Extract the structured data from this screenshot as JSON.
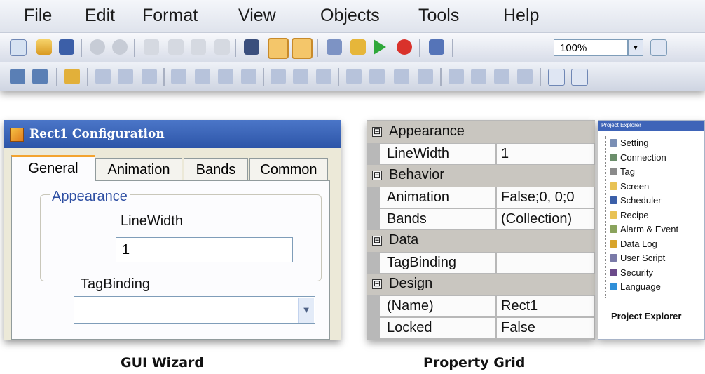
{
  "menubar": {
    "items": [
      "File",
      "Edit",
      "Format",
      "View",
      "Objects",
      "Tools",
      "Help"
    ]
  },
  "toolbar": {
    "zoom_value": "100%",
    "icons1": [
      "new-icon",
      "open-icon",
      "save-icon",
      "undo-icon",
      "redo-icon",
      "cut-icon",
      "copy-icon",
      "paste-icon",
      "delete-icon",
      "find-icon",
      "grid-icon",
      "snap-icon",
      "build-icon",
      "run-icon",
      "play-icon",
      "stop-icon",
      "download-icon"
    ],
    "icons2": [
      "bring-front-icon",
      "send-back-icon",
      "lock-icon",
      "align-left-icon",
      "align-center-icon",
      "align-right-icon",
      "align-top-icon",
      "align-bottom-icon",
      "align-middle-icon",
      "same-size-icon",
      "group-icon",
      "ungroup-icon",
      "center-icon",
      "space-h-icon",
      "space-h-increase-icon",
      "space-h-decrease-icon",
      "space-h-remove-icon",
      "space-v-icon",
      "space-v-increase-icon",
      "space-v-decrease-icon",
      "space-v-remove-icon",
      "tab-order-icon",
      "frame-icon"
    ]
  },
  "wizard": {
    "title": "Rect1 Configuration",
    "tabs": [
      "General",
      "Animation",
      "Bands",
      "Common"
    ],
    "group_label": "Appearance",
    "linewidth_label": "LineWidth",
    "linewidth_value": "1",
    "tagbinding_label": "TagBinding",
    "tagbinding_value": "",
    "caption": "GUI Wizard"
  },
  "property_grid": {
    "rows": [
      {
        "category": "Appearance"
      },
      {
        "name": "LineWidth",
        "value": "1"
      },
      {
        "category": "Behavior"
      },
      {
        "name": "Animation",
        "value": "False;0, 0;0"
      },
      {
        "name": "Bands",
        "value": "(Collection)"
      },
      {
        "category": "Data"
      },
      {
        "name": "TagBinding",
        "value": ""
      },
      {
        "category": "Design"
      },
      {
        "name": "(Name)",
        "value": "Rect1"
      },
      {
        "name": "Locked",
        "value": "False"
      }
    ],
    "collapse_glyph": "⊟",
    "caption": "Property Grid"
  },
  "project_explorer": {
    "title": "Project Explorer",
    "items": [
      {
        "label": "Setting",
        "icon": "setting-icon",
        "color": "#7a8fb5"
      },
      {
        "label": "Connection",
        "icon": "connection-icon",
        "color": "#6b8e6b"
      },
      {
        "label": "Tag",
        "icon": "tag-icon",
        "color": "#8a8a8a"
      },
      {
        "label": "Screen",
        "icon": "folder-icon",
        "color": "#e8c254"
      },
      {
        "label": "Scheduler",
        "icon": "scheduler-icon",
        "color": "#3b5fa8"
      },
      {
        "label": "Recipe",
        "icon": "folder-icon",
        "color": "#e8c254"
      },
      {
        "label": "Alarm & Event",
        "icon": "alarm-icon",
        "color": "#8aa35c"
      },
      {
        "label": "Data Log",
        "icon": "datalog-icon",
        "color": "#d8a42a"
      },
      {
        "label": "User Script",
        "icon": "script-icon",
        "color": "#7a7aa8"
      },
      {
        "label": "Security",
        "icon": "security-icon",
        "color": "#6b4a8a"
      },
      {
        "label": "Language",
        "icon": "language-icon",
        "color": "#2f8fd8"
      }
    ],
    "footer": "Project Explorer"
  }
}
